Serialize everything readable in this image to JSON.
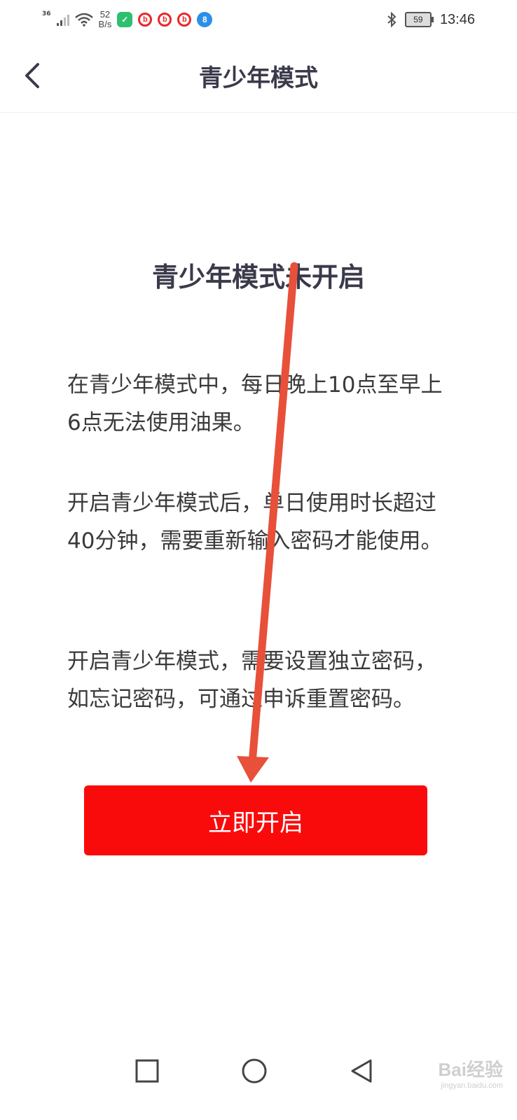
{
  "status_bar": {
    "network": "36",
    "speed_value": "52",
    "speed_unit": "B/s",
    "battery": "59",
    "time": "13:46",
    "icons": [
      "signal-icon",
      "wifi-icon",
      "app-green-icon",
      "app-red-icon",
      "app-red-icon",
      "app-red-icon",
      "app-blue-icon",
      "bluetooth-icon",
      "battery-icon"
    ]
  },
  "header": {
    "back_icon": "chevron-left-icon",
    "title": "青少年模式"
  },
  "main": {
    "title": "青少年模式未开启",
    "paragraphs": [
      "在青少年模式中，每日晚上10点至早上6点无法使用油果。",
      "开启青少年模式后，单日使用时长超过40分钟，需要重新输入密码才能使用。",
      "开启青少年模式，需要设置独立密码，如忘记密码，可通过申诉重置密码。"
    ],
    "button_label": "立即开启",
    "button_color": "#fa0b0b"
  },
  "annotation": {
    "arrow_color": "#e8503a"
  },
  "nav_bar": {
    "icons": [
      "recent-apps-icon",
      "home-icon",
      "back-icon"
    ]
  },
  "watermark": {
    "text": "Bai经验",
    "url_text": "jingyan.baidu.com"
  }
}
